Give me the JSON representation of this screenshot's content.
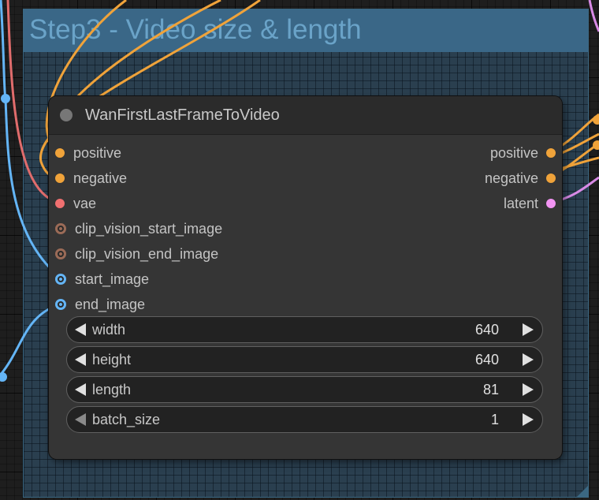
{
  "group": {
    "title": "Step3 - Video size & length",
    "color": "#3a6787"
  },
  "node": {
    "title": "WanFirstLastFrameToVideo",
    "inputs": [
      {
        "label": "positive",
        "color": "#f0a33a",
        "style": "filled"
      },
      {
        "label": "negative",
        "color": "#f0a33a",
        "style": "filled"
      },
      {
        "label": "vae",
        "color": "#f07070",
        "style": "filled"
      },
      {
        "label": "clip_vision_start_image",
        "color": "#9b6b57",
        "style": "hollow"
      },
      {
        "label": "clip_vision_end_image",
        "color": "#9b6b57",
        "style": "hollow"
      },
      {
        "label": "start_image",
        "color": "#64b5f6",
        "style": "hollow"
      },
      {
        "label": "end_image",
        "color": "#64b5f6",
        "style": "hollow"
      }
    ],
    "outputs": [
      {
        "label": "positive",
        "color": "#f0a33a"
      },
      {
        "label": "negative",
        "color": "#f0a33a"
      },
      {
        "label": "latent",
        "color": "#f294f2"
      }
    ],
    "widgets": [
      {
        "label": "width",
        "value": "640"
      },
      {
        "label": "height",
        "value": "640"
      },
      {
        "label": "length",
        "value": "81"
      },
      {
        "label": "batch_size",
        "value": "1"
      }
    ]
  },
  "wire_colors": {
    "conditioning": "#f0a33a",
    "vae": "#e06c6c",
    "image": "#64b5f6",
    "latent": "#d88ae6",
    "clip_vision": "#a0a0a0"
  }
}
